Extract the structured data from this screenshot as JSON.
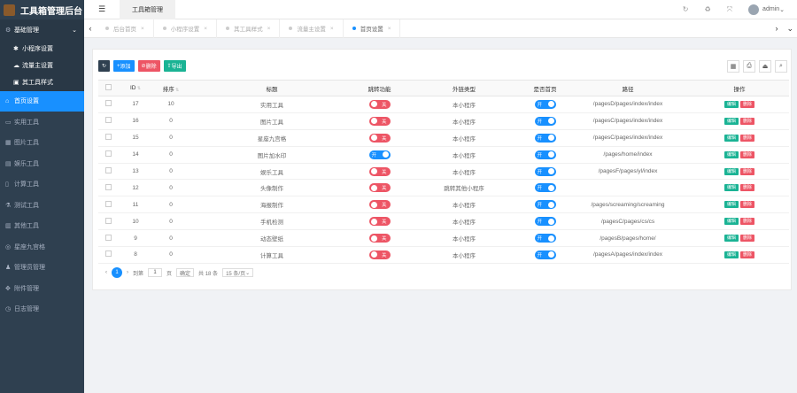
{
  "app": {
    "title": "工具箱管理后台"
  },
  "sidebar": {
    "groups": [
      {
        "label": "基础管理",
        "icon": "gear-icon",
        "open": true,
        "children": [
          {
            "label": "小程序设置",
            "icon": "gear-icon"
          },
          {
            "label": "流量主设置",
            "icon": "cloud-icon"
          },
          {
            "label": "其工具样式",
            "icon": "truck-icon"
          }
        ]
      }
    ],
    "items": [
      {
        "label": "首页设置",
        "icon": "home-icon",
        "active": true
      },
      {
        "label": "实用工具",
        "icon": "tool-icon"
      },
      {
        "label": "图片工具",
        "icon": "image-icon"
      },
      {
        "label": "娱乐工具",
        "icon": "book-icon"
      },
      {
        "label": "计算工具",
        "icon": "calculator-icon"
      },
      {
        "label": "测试工具",
        "icon": "flask-icon"
      },
      {
        "label": "其他工具",
        "icon": "box-icon"
      },
      {
        "label": "星座九宫格",
        "icon": "circle-icon"
      },
      {
        "label": "管理员管理",
        "icon": "user-icon"
      },
      {
        "label": "附件管理",
        "icon": "attachment-icon"
      },
      {
        "label": "日志管理",
        "icon": "log-icon"
      }
    ]
  },
  "topbar": {
    "menu_icon": "☰",
    "tab": "工具箱管理",
    "user": "admin"
  },
  "tabs": [
    {
      "label": "后台首页",
      "active": false
    },
    {
      "label": "小程序设置",
      "active": false
    },
    {
      "label": "其工具样式",
      "active": false
    },
    {
      "label": "流量主设置",
      "active": false
    },
    {
      "label": "首页设置",
      "active": true
    }
  ],
  "toolbar": {
    "add": "添加",
    "delete": "删除",
    "export": "导出"
  },
  "table": {
    "columns": [
      "ID",
      "排序",
      "标题",
      "跳转功能",
      "外链类型",
      "是否首页",
      "路径",
      "操作"
    ],
    "switch_on": "开",
    "switch_off": "关",
    "edit_label": "编辑",
    "delete_label": "删除",
    "rows": [
      {
        "id": "17",
        "sort": "10",
        "title": "实用工具",
        "jump": false,
        "type": "本小程序",
        "home": true,
        "path": "/pagesD/pages/index/index"
      },
      {
        "id": "16",
        "sort": "0",
        "title": "图片工具",
        "jump": false,
        "type": "本小程序",
        "home": true,
        "path": "/pagesC/pages/index/index"
      },
      {
        "id": "15",
        "sort": "0",
        "title": "星座九宫格",
        "jump": false,
        "type": "本小程序",
        "home": true,
        "path": "/pagesC/pages/index/index"
      },
      {
        "id": "14",
        "sort": "0",
        "title": "图片加水印",
        "jump": true,
        "type": "本小程序",
        "home": true,
        "path": "/pages/home/index"
      },
      {
        "id": "13",
        "sort": "0",
        "title": "娱乐工具",
        "jump": false,
        "type": "本小程序",
        "home": true,
        "path": "/pagesF/pages/yl/index"
      },
      {
        "id": "12",
        "sort": "0",
        "title": "头像制作",
        "jump": false,
        "type": "跳转其他小程序",
        "home": true,
        "path": ""
      },
      {
        "id": "11",
        "sort": "0",
        "title": "海报制作",
        "jump": false,
        "type": "本小程序",
        "home": true,
        "path": "/pages/screaming/screaming"
      },
      {
        "id": "10",
        "sort": "0",
        "title": "手机检测",
        "jump": false,
        "type": "本小程序",
        "home": true,
        "path": "/pagesC/pages/cs/cs"
      },
      {
        "id": "9",
        "sort": "0",
        "title": "动态壁纸",
        "jump": false,
        "type": "本小程序",
        "home": true,
        "path": "/pagesB/pages/home/"
      },
      {
        "id": "8",
        "sort": "0",
        "title": "计算工具",
        "jump": false,
        "type": "本小程序",
        "home": true,
        "path": "/pagesA/pages/index/index"
      }
    ]
  },
  "pager": {
    "page": "1",
    "goto": "到第",
    "page_input": "1",
    "page_unit": "页",
    "confirm": "确定",
    "total": "共 18 条",
    "per_page": "15 条/页"
  }
}
